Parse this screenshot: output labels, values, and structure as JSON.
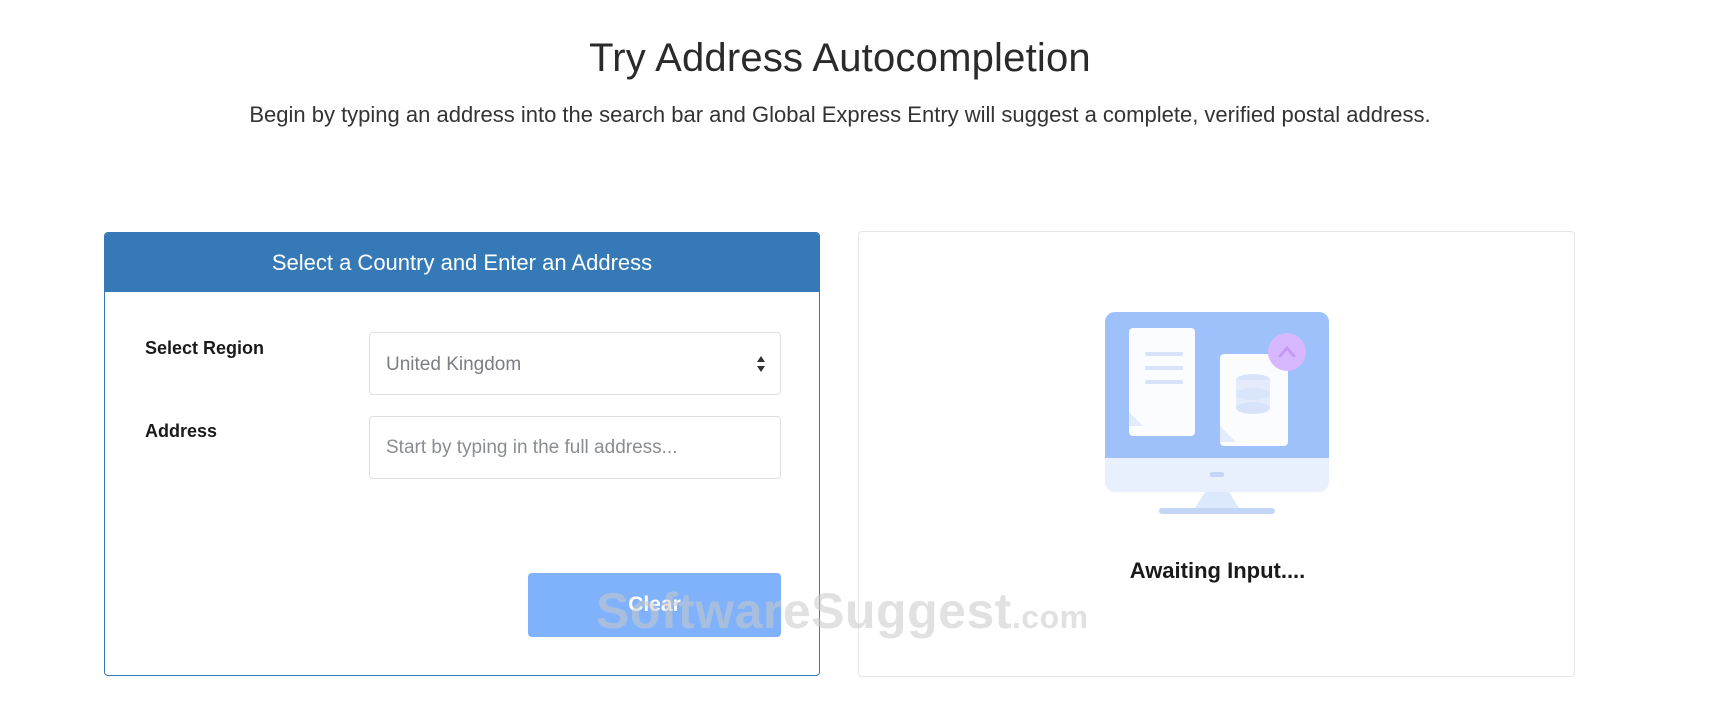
{
  "hero": {
    "title": "Try Address Autocompletion",
    "subtitle": "Begin by typing an address into the search bar and Global Express Entry will suggest a complete, verified postal address."
  },
  "form": {
    "header": "Select a Country and Enter an Address",
    "region_label": "Select Region",
    "region_value": "United Kingdom",
    "address_label": "Address",
    "address_value": "",
    "address_placeholder": "Start by typing in the full address...",
    "clear_label": "Clear"
  },
  "result": {
    "status_text": "Awaiting Input....",
    "illustration": "monitor-with-documents-icon"
  },
  "watermark": {
    "brand": "SoftwareSuggest",
    "suffix": ".com"
  },
  "colors": {
    "header_blue": "#357ab7",
    "button_blue": "#7fb2fb",
    "illustration_blue": "#9ec0fb"
  }
}
